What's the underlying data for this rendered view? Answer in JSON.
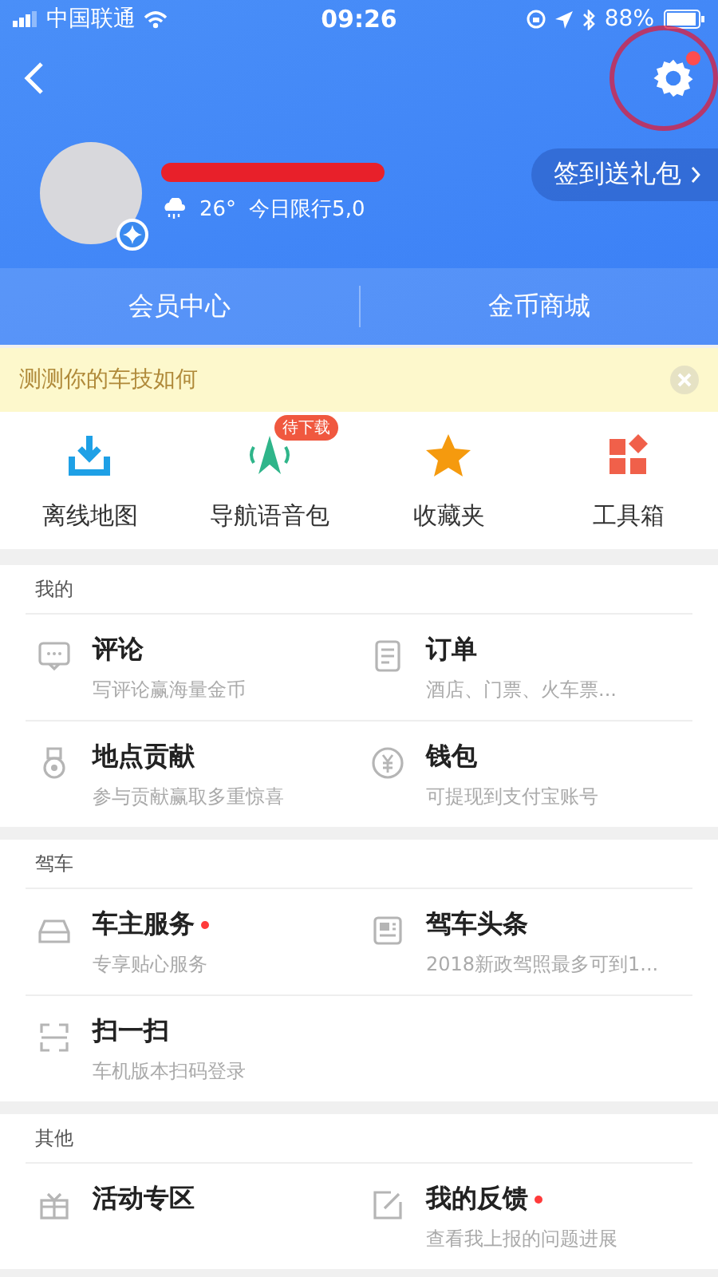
{
  "status_bar": {
    "carrier": "中国联通",
    "time": "09:26",
    "battery": "88%"
  },
  "header": {
    "settings_dot": true,
    "checkin_button": "签到送礼包",
    "temperature": "26°",
    "restriction": "今日限行5,0"
  },
  "header_tabs": [
    "会员中心",
    "金币商城"
  ],
  "banner": {
    "text": "测测你的车技如何"
  },
  "shortcuts": [
    {
      "label": "离线地图",
      "kind": "download"
    },
    {
      "label": "导航语音包",
      "kind": "voice",
      "badge": "待下载"
    },
    {
      "label": "收藏夹",
      "kind": "star"
    },
    {
      "label": "工具箱",
      "kind": "tools"
    }
  ],
  "sections": [
    {
      "title": "我的",
      "items": [
        {
          "kind": "comment",
          "title": "评论",
          "subtitle": "写评论赢海量金币",
          "dot": false
        },
        {
          "kind": "order",
          "title": "订单",
          "subtitle": "酒店、门票、火车票...",
          "dot": false
        },
        {
          "kind": "medal",
          "title": "地点贡献",
          "subtitle": "参与贡献赢取多重惊喜",
          "dot": false
        },
        {
          "kind": "wallet",
          "title": "钱包",
          "subtitle": "可提现到支付宝账号",
          "dot": false
        }
      ]
    },
    {
      "title": "驾车",
      "items": [
        {
          "kind": "car",
          "title": "车主服务",
          "subtitle": "专享贴心服务",
          "dot": true
        },
        {
          "kind": "news",
          "title": "驾车头条",
          "subtitle": "2018新政驾照最多可到1...",
          "dot": false
        },
        {
          "kind": "scan",
          "title": "扫一扫",
          "subtitle": "车机版本扫码登录",
          "dot": false
        }
      ]
    },
    {
      "title": "其他",
      "items": [
        {
          "kind": "gift",
          "title": "活动专区",
          "dot": false
        },
        {
          "kind": "edit",
          "title": "我的反馈",
          "subtitle": "查看我上报的问题进展",
          "dot": true
        }
      ]
    }
  ]
}
